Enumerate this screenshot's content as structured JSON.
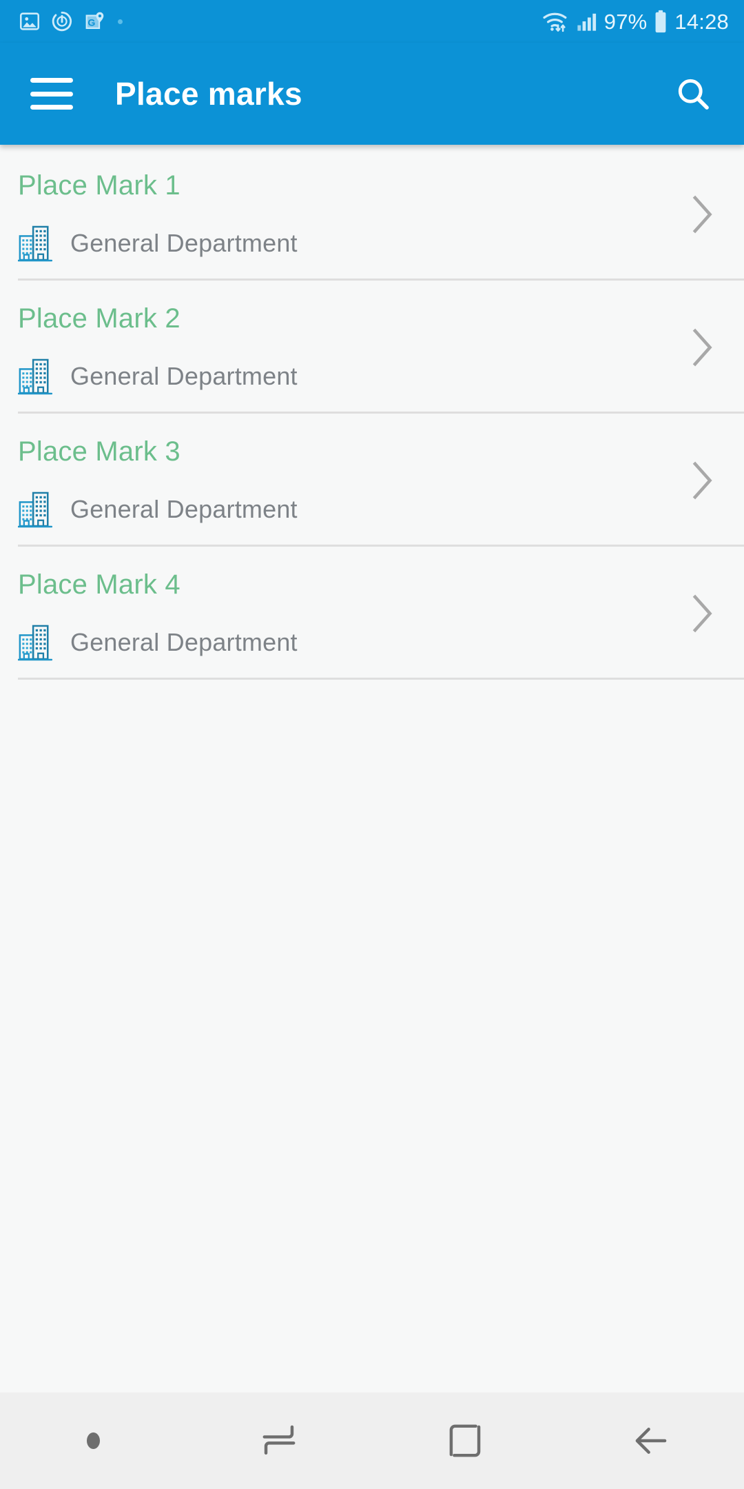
{
  "status_bar": {
    "left_icons": [
      {
        "name": "image-icon",
        "label": "Screenshot"
      },
      {
        "name": "timer-icon",
        "label": "Timer"
      },
      {
        "name": "google-maps-icon",
        "label": "Maps"
      }
    ],
    "overflow_dot": "·",
    "wifi_icon": "wifi-icon",
    "signal_icon": "signal-bars-icon",
    "battery_percent": "97%",
    "battery_icon": "battery-icon",
    "time": "14:28"
  },
  "app_bar": {
    "menu_icon": "hamburger-menu-icon",
    "title": "Place marks",
    "search_icon": "search-icon",
    "background_color": "#0C92D6"
  },
  "colors": {
    "accent_blue": "#0C92D6",
    "title_green": "#6CBE8C",
    "subtitle_gray": "#7D8287",
    "page_background": "#F7F8F8",
    "divider": "#DEDEDE",
    "nav_background": "#EFEFEF"
  },
  "list": {
    "items": [
      {
        "title": "Place Mark 1",
        "subtitle": "General Department",
        "icon": "building-icon",
        "chevron": "chevron-right-icon"
      },
      {
        "title": "Place Mark 2",
        "subtitle": "General Department",
        "icon": "building-icon",
        "chevron": "chevron-right-icon"
      },
      {
        "title": "Place Mark 3",
        "subtitle": "General Department",
        "icon": "building-icon",
        "chevron": "chevron-right-icon"
      },
      {
        "title": "Place Mark 4",
        "subtitle": "General Department",
        "icon": "building-icon",
        "chevron": "chevron-right-icon"
      }
    ]
  },
  "nav_bar": {
    "buttons": [
      {
        "name": "nav-dot-indicator",
        "label": ""
      },
      {
        "name": "recents-button",
        "label": "Recents"
      },
      {
        "name": "home-button",
        "label": "Home"
      },
      {
        "name": "back-button",
        "label": "Back"
      }
    ]
  }
}
